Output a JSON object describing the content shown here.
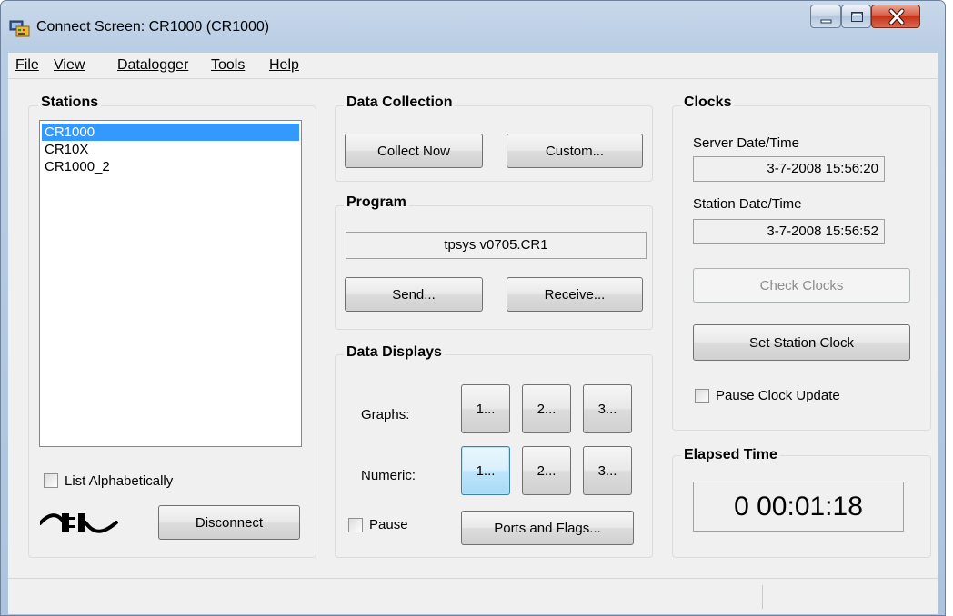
{
  "window": {
    "title": "Connect Screen: CR1000 (CR1000)",
    "controls": {
      "minimize": "minimize",
      "maximize": "maximize",
      "close": "close"
    }
  },
  "menu": {
    "items": [
      {
        "label": "File",
        "underline": "F"
      },
      {
        "label": "View",
        "underline": "V"
      },
      {
        "label": "Datalogger",
        "underline": "D"
      },
      {
        "label": "Tools",
        "underline": "T"
      },
      {
        "label": "Help",
        "underline": "H"
      }
    ]
  },
  "stations": {
    "title": "Stations",
    "items": [
      {
        "label": "CR1000",
        "selected": true
      },
      {
        "label": "CR10X",
        "selected": false
      },
      {
        "label": "CR1000_2",
        "selected": false
      }
    ],
    "list_alphabetically_label": "List Alphabetically",
    "list_alphabetically_checked": false,
    "connection_icon": "plug-icon",
    "disconnect_label": "Disconnect"
  },
  "data_collection": {
    "title": "Data Collection",
    "collect_now_label": "Collect Now",
    "custom_label": "Custom..."
  },
  "program": {
    "title": "Program",
    "filename": "tpsys v0705.CR1",
    "send_label": "Send...",
    "receive_label": "Receive..."
  },
  "data_displays": {
    "title": "Data Displays",
    "graphs_label": "Graphs:",
    "numeric_label": "Numeric:",
    "graph_buttons": [
      "1...",
      "2...",
      "3..."
    ],
    "numeric_buttons": [
      "1...",
      "2...",
      "3..."
    ],
    "focused_numeric_button": 0,
    "pause_label": "Pause",
    "pause_checked": false,
    "ports_flags_label": "Ports and Flags..."
  },
  "clocks": {
    "title": "Clocks",
    "server_label": "Server Date/Time",
    "server_value": "3-7-2008 15:56:20",
    "station_label": "Station Date/Time",
    "station_value": "3-7-2008 15:56:52",
    "check_clocks_label": "Check Clocks",
    "check_clocks_enabled": false,
    "set_station_clock_label": "Set Station Clock",
    "pause_update_label": "Pause Clock Update",
    "pause_update_checked": false
  },
  "elapsed": {
    "title": "Elapsed Time",
    "value": "0 00:01:18"
  },
  "colors": {
    "selection": "#3399ff",
    "window_frame": "#b9cde4",
    "close_button": "#c4331a",
    "focus_button": "#bee6fd",
    "face": "#f0f0f0"
  }
}
